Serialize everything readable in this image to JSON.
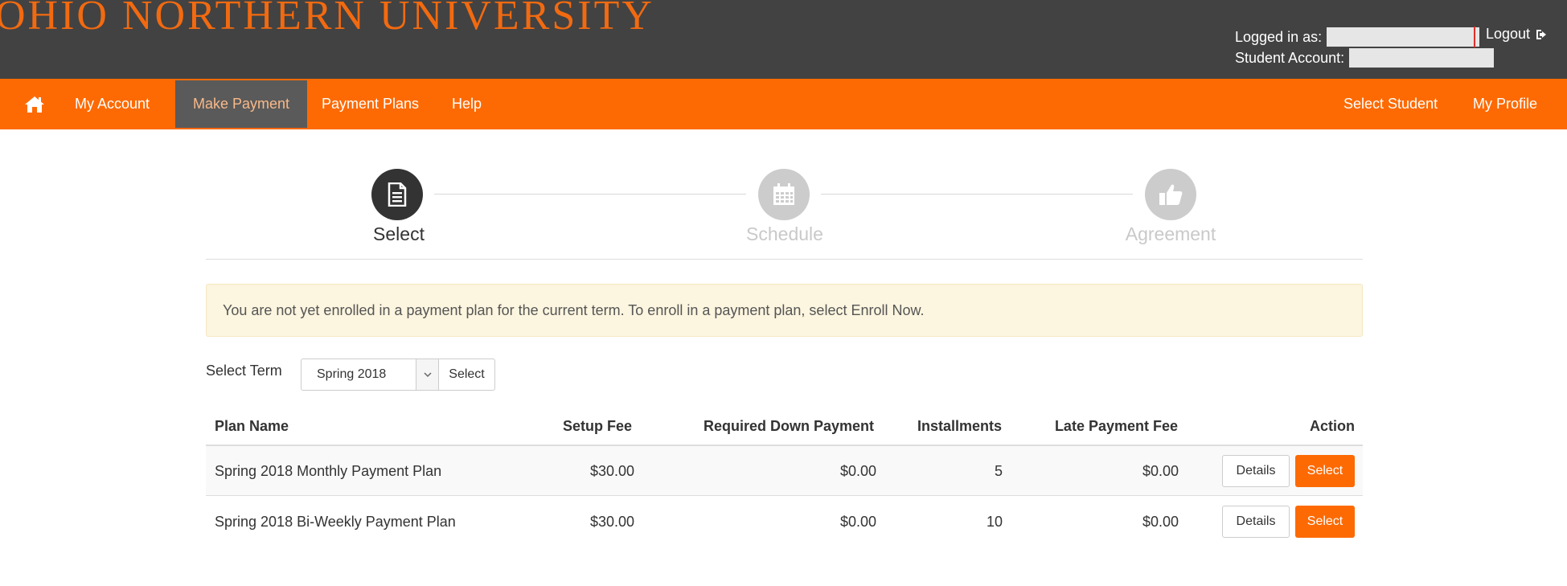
{
  "header": {
    "brand": "OHIO NORTHERN UNIVERSITY",
    "logged_in_label": "Logged in as:",
    "student_account_label": "Student Account:",
    "logout_label": "Logout"
  },
  "nav": {
    "items": [
      {
        "label": "My Account"
      },
      {
        "label": "Make Payment",
        "active": true
      },
      {
        "label": "Payment Plans"
      },
      {
        "label": "Help"
      }
    ],
    "right_items": [
      {
        "label": "Select Student"
      },
      {
        "label": "My Profile"
      }
    ]
  },
  "steps": [
    {
      "label": "Select",
      "icon": "document-icon",
      "active": true
    },
    {
      "label": "Schedule",
      "icon": "calendar-icon",
      "active": false
    },
    {
      "label": "Agreement",
      "icon": "thumbs-up-icon",
      "active": false
    }
  ],
  "alert": {
    "text": "You are not yet enrolled in a payment plan for the current term. To enroll in a payment plan, select Enroll Now."
  },
  "term": {
    "label": "Select Term",
    "selected": "Spring 2018",
    "button_label": "Select"
  },
  "table": {
    "headers": {
      "plan_name": "Plan Name",
      "setup_fee": "Setup Fee",
      "down_payment": "Required Down Payment",
      "installments": "Installments",
      "late_fee": "Late Payment Fee",
      "action": "Action"
    },
    "rows": [
      {
        "plan_name": "Spring 2018 Monthly Payment Plan",
        "setup_fee": "$30.00",
        "down_payment": "$0.00",
        "installments": "5",
        "late_fee": "$0.00",
        "details_label": "Details",
        "select_label": "Select"
      },
      {
        "plan_name": "Spring 2018 Bi-Weekly Payment Plan",
        "setup_fee": "$30.00",
        "down_payment": "$0.00",
        "installments": "10",
        "late_fee": "$0.00",
        "details_label": "Details",
        "select_label": "Select"
      }
    ]
  },
  "colors": {
    "brand_orange": "#fd6a03",
    "header_dark": "#424242",
    "nav_active": "#5a5a5a",
    "alert_bg": "#fcf5df"
  }
}
